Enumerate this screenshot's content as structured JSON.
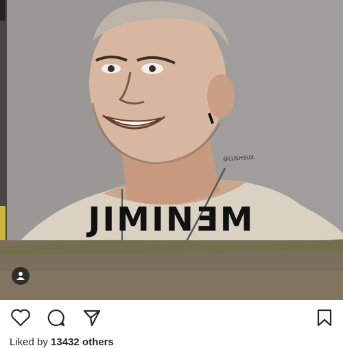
{
  "post": {
    "mural_text": "JIMINƎM",
    "artist_handle": "@LUSHSUX",
    "tag_icon": "person-icon"
  },
  "actions": {
    "like_icon": "heart-icon",
    "comment_icon": "comment-icon",
    "share_icon": "paper-plane-icon",
    "save_icon": "bookmark-icon"
  },
  "likes": {
    "prefix": "Liked by",
    "count": "13432 others"
  }
}
